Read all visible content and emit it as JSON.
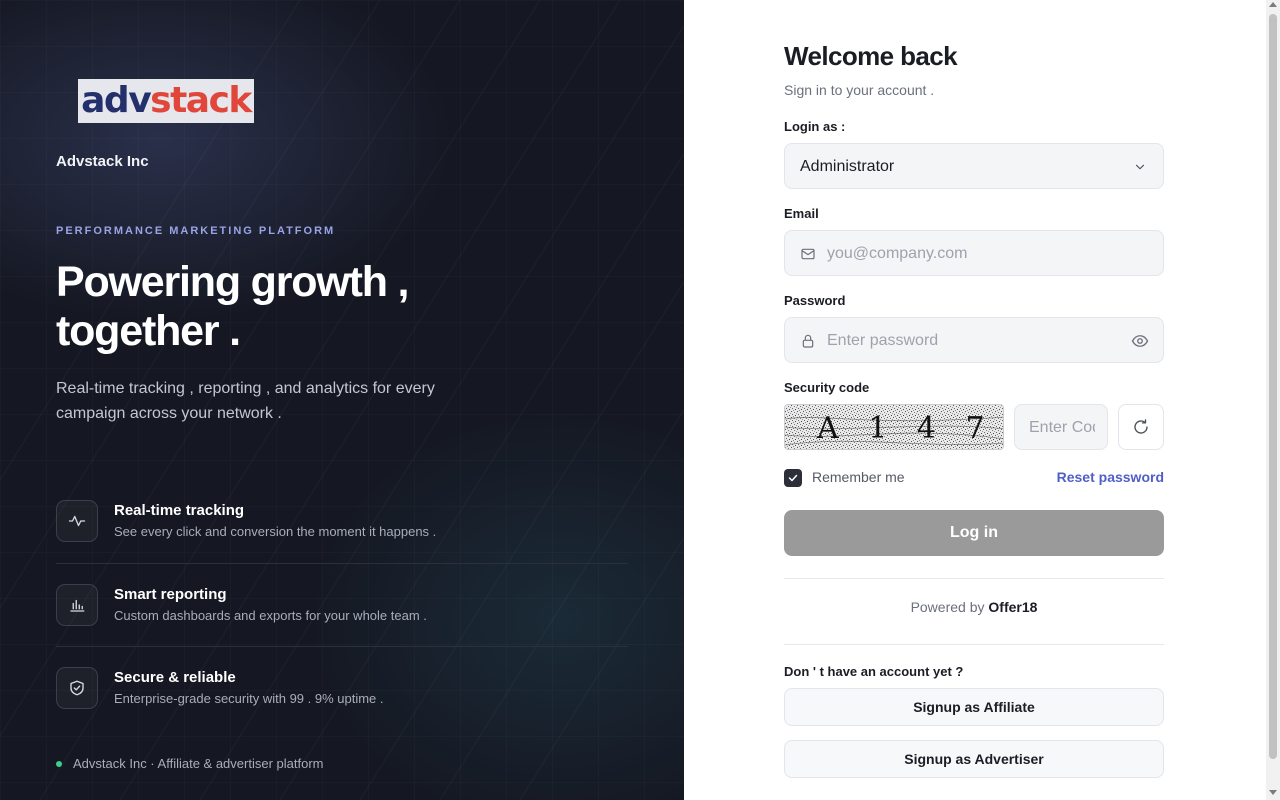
{
  "brand": {
    "logo_part1": "adv",
    "logo_part2": "stack",
    "company": "Advstack Inc",
    "eyebrow": "PERFORMANCE MARKETING PLATFORM",
    "hero_line1": "Powering growth ,",
    "hero_line2": "together .",
    "subtitle": "Real-time tracking , reporting , and analytics for every campaign across your network .",
    "colors": {
      "logo_adv": "#23306b",
      "logo_stack": "#e0463a",
      "accent": "#9aa3e6",
      "status_dot": "#3ccf8e"
    }
  },
  "features": [
    {
      "icon": "activity-icon",
      "title": "Real-time tracking",
      "desc": "See every click and conversion the moment it happens ."
    },
    {
      "icon": "bar-chart-icon",
      "title": "Smart reporting",
      "desc": "Custom dashboards and exports for your whole team ."
    },
    {
      "icon": "shield-check-icon",
      "title": "Secure & reliable",
      "desc": "Enterprise-grade security with 99 . 9% uptime ."
    }
  ],
  "footer_left": "Advstack Inc · Affiliate & advertiser platform",
  "form": {
    "title": "Welcome back",
    "subtitle": "Sign in to your account .",
    "login_as_label": "Login as :",
    "login_as_value": "Administrator",
    "email_label": "Email",
    "email_placeholder": "you@company.com",
    "password_label": "Password",
    "password_placeholder": "Enter password",
    "security_label": "Security code",
    "captcha_text": "A 1 4 7",
    "captcha_placeholder": "Enter Code",
    "remember_label": "Remember me",
    "remember_checked": true,
    "reset_label": "Reset password",
    "login_button": "Log in",
    "powered_prefix": "Powered by",
    "powered_brand": "Offer18",
    "no_account": "Don ' t have an account yet ?",
    "signup_affiliate": "Signup as Affiliate",
    "signup_advertiser": "Signup as Advertiser",
    "colors": {
      "link": "#4f5fc9",
      "button_disabled": "#9a9a9a"
    }
  }
}
